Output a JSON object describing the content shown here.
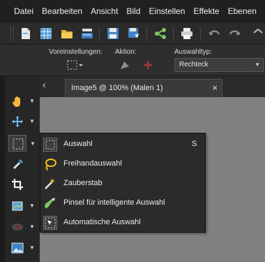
{
  "menu": [
    "Datei",
    "Bearbeiten",
    "Ansicht",
    "Bild",
    "Einstellen",
    "Effekte",
    "Ebenen"
  ],
  "toolbar_icons": [
    "new-document-icon",
    "grid-icon",
    "open-folder-icon",
    "scan-icon",
    "save-icon",
    "save-as-icon",
    "share-icon",
    "print-icon",
    "undo-icon",
    "redo-icon",
    "more-icon"
  ],
  "options": {
    "presets_label": "Voreinstellungen:",
    "action_label": "Aktion:",
    "selection_type_label": "Auswahltyp:",
    "selection_type_value": "Rechteck"
  },
  "document_tab": {
    "title": "Image5 @ 100% (Malen 1)",
    "close": "×"
  },
  "tab_nav": "‹",
  "tools": [
    {
      "icon": "pan-hand-icon",
      "active": false
    },
    {
      "icon": "move-icon",
      "active": false
    },
    {
      "icon": "selection-icon",
      "active": true
    },
    {
      "icon": "eyedropper-icon",
      "active": false
    },
    {
      "icon": "crop-icon",
      "active": false
    },
    {
      "icon": "straighten-icon",
      "active": false
    },
    {
      "icon": "red-eye-icon",
      "active": false
    },
    {
      "icon": "image-icon",
      "active": false
    }
  ],
  "flyout": [
    {
      "label": "Auswahl",
      "shortcut": "S",
      "icon": "rect-select-icon"
    },
    {
      "label": "Freihandauswahl",
      "shortcut": "",
      "icon": "lasso-icon"
    },
    {
      "label": "Zauberstab",
      "shortcut": "",
      "icon": "magic-wand-icon"
    },
    {
      "label": "Pinsel für intelligente Auswahl",
      "shortcut": "",
      "icon": "smart-brush-icon"
    },
    {
      "label": "Automatische Auswahl",
      "shortcut": "",
      "icon": "auto-select-icon"
    }
  ],
  "colors": {
    "accent": "#4aa3df",
    "menubar": "#202020",
    "canvas": "#808080",
    "lasso": "#f2c21e"
  }
}
